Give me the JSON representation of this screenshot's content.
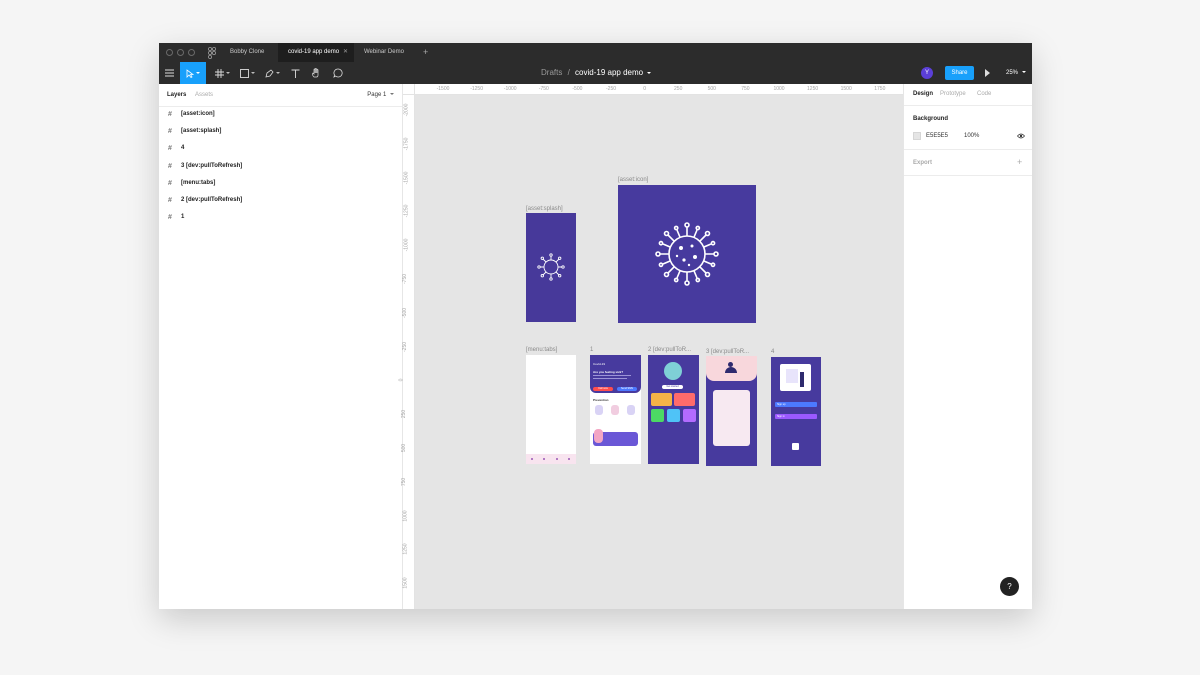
{
  "tabs": [
    {
      "label": "Bobby Clone"
    },
    {
      "label": "covid-19 app demo",
      "close": "✕"
    },
    {
      "label": "Webinar Demo"
    }
  ],
  "toolbar": {
    "breadcrumb_root": "Drafts",
    "breadcrumb_sep": "/",
    "file_name": "covid-19 app demo",
    "avatar_initial": "Y",
    "share_label": "Share",
    "zoom": "25%"
  },
  "left_panel": {
    "tab_layers": "Layers",
    "tab_assets": "Assets",
    "page": "Page 1",
    "layers": [
      {
        "label": "[asset:icon]"
      },
      {
        "label": "[asset:splash]"
      },
      {
        "label": "4"
      },
      {
        "label": "3 [dev:pullToRefresh]"
      },
      {
        "label": "[menu:tabs]"
      },
      {
        "label": "2 [dev:pullToRefresh]"
      },
      {
        "label": "1"
      }
    ]
  },
  "ruler": {
    "top": [
      "-1500",
      "-1250",
      "-1000",
      "-750",
      "-500",
      "-250",
      "0",
      "250",
      "500",
      "750",
      "1000",
      "1250",
      "1500",
      "1750"
    ],
    "left": [
      "-2000",
      "-1750",
      "-1500",
      "-1250",
      "-1000",
      "-750",
      "-500",
      "-250",
      "0",
      "250",
      "500",
      "750",
      "1000",
      "1250",
      "1500"
    ]
  },
  "canvas": {
    "frames": [
      {
        "label": "[asset:splash]"
      },
      {
        "label": "[asset:icon]"
      },
      {
        "label": "[menu:tabs]"
      },
      {
        "label": "1"
      },
      {
        "label": "2 [dev:pullToR..."
      },
      {
        "label": "3 [dev:pullToR..."
      },
      {
        "label": "4"
      }
    ],
    "mini": {
      "app_title": "Covid-19",
      "question": "Are you feeling sick?",
      "call_label": "Call now",
      "sms_label": "Send SMS",
      "prevention": "Prevention",
      "get_started": "Get started",
      "cta_1": "Sign up",
      "cta_2": "Sign in"
    },
    "colors": {
      "brand_purple": "#473a9e",
      "splash_purple": "#47399a",
      "pink": "#f8d7dc",
      "light_pink": "#f7e9f1"
    }
  },
  "right_panel": {
    "tab_design": "Design",
    "tab_prototype": "Prototype",
    "tab_code": "Code",
    "background_title": "Background",
    "background_hex": "E5E5E5",
    "background_opacity": "100%",
    "export_title": "Export",
    "export_add": "+"
  },
  "help_label": "?"
}
